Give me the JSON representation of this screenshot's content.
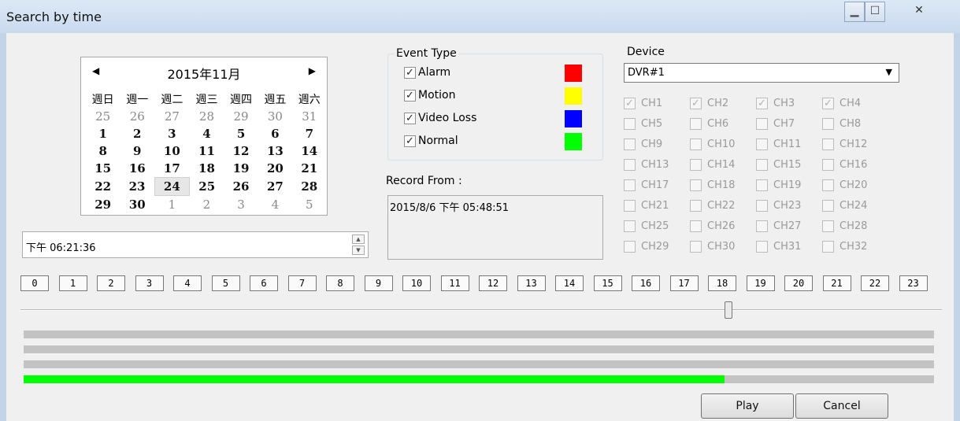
{
  "window": {
    "title": "Search by time"
  },
  "calendar": {
    "month_label": "2015年11月",
    "weekdays": [
      "週日",
      "週一",
      "週二",
      "週三",
      "週四",
      "週五",
      "週六"
    ],
    "rows": [
      [
        [
          "25",
          "other"
        ],
        [
          "26",
          "other"
        ],
        [
          "27",
          "other"
        ],
        [
          "28",
          "other"
        ],
        [
          "29",
          "other"
        ],
        [
          "30",
          "other"
        ],
        [
          "31",
          "other"
        ]
      ],
      [
        [
          "1",
          "cur"
        ],
        [
          "2",
          "cur"
        ],
        [
          "3",
          "cur"
        ],
        [
          "4",
          "cur"
        ],
        [
          "5",
          "cur"
        ],
        [
          "6",
          "cur"
        ],
        [
          "7",
          "cur"
        ]
      ],
      [
        [
          "8",
          "cur"
        ],
        [
          "9",
          "cur"
        ],
        [
          "10",
          "cur"
        ],
        [
          "11",
          "cur"
        ],
        [
          "12",
          "cur"
        ],
        [
          "13",
          "cur"
        ],
        [
          "14",
          "cur"
        ]
      ],
      [
        [
          "15",
          "cur"
        ],
        [
          "16",
          "cur"
        ],
        [
          "17",
          "cur"
        ],
        [
          "18",
          "cur"
        ],
        [
          "19",
          "cur"
        ],
        [
          "20",
          "cur"
        ],
        [
          "21",
          "cur"
        ]
      ],
      [
        [
          "22",
          "cur"
        ],
        [
          "23",
          "cur"
        ],
        [
          "24",
          "today"
        ],
        [
          "25",
          "cur"
        ],
        [
          "26",
          "cur"
        ],
        [
          "27",
          "cur"
        ],
        [
          "28",
          "cur"
        ]
      ],
      [
        [
          "29",
          "cur"
        ],
        [
          "30",
          "cur"
        ],
        [
          "1",
          "other"
        ],
        [
          "2",
          "other"
        ],
        [
          "3",
          "other"
        ],
        [
          "4",
          "other"
        ],
        [
          "5",
          "other"
        ]
      ]
    ]
  },
  "time_field": {
    "value": "下午 06:21:36"
  },
  "event_type": {
    "legend": "Event Type",
    "items": [
      {
        "label": "Alarm",
        "checked": true,
        "color": "#ff0000"
      },
      {
        "label": "Motion",
        "checked": true,
        "color": "#ffff00"
      },
      {
        "label": "Video Loss",
        "checked": true,
        "color": "#0000ff"
      },
      {
        "label": "Normal",
        "checked": true,
        "color": "#00ff00"
      }
    ]
  },
  "record_from": {
    "label": "Record From :",
    "value": "2015/8/6 下午 05:48:51"
  },
  "device": {
    "label": "Device",
    "selected": "DVR#1",
    "channels": [
      {
        "label": "CH1",
        "checked": true
      },
      {
        "label": "CH2",
        "checked": true
      },
      {
        "label": "CH3",
        "checked": true
      },
      {
        "label": "CH4",
        "checked": true
      },
      {
        "label": "CH5",
        "checked": false
      },
      {
        "label": "CH6",
        "checked": false
      },
      {
        "label": "CH7",
        "checked": false
      },
      {
        "label": "CH8",
        "checked": false
      },
      {
        "label": "CH9",
        "checked": false
      },
      {
        "label": "CH10",
        "checked": false
      },
      {
        "label": "CH11",
        "checked": false
      },
      {
        "label": "CH12",
        "checked": false
      },
      {
        "label": "CH13",
        "checked": false
      },
      {
        "label": "CH14",
        "checked": false
      },
      {
        "label": "CH15",
        "checked": false
      },
      {
        "label": "CH16",
        "checked": false
      },
      {
        "label": "CH17",
        "checked": false
      },
      {
        "label": "CH18",
        "checked": false
      },
      {
        "label": "CH19",
        "checked": false
      },
      {
        "label": "CH20",
        "checked": false
      },
      {
        "label": "CH21",
        "checked": false
      },
      {
        "label": "CH22",
        "checked": false
      },
      {
        "label": "CH23",
        "checked": false
      },
      {
        "label": "CH24",
        "checked": false
      },
      {
        "label": "CH25",
        "checked": false
      },
      {
        "label": "CH26",
        "checked": false
      },
      {
        "label": "CH27",
        "checked": false
      },
      {
        "label": "CH28",
        "checked": false
      },
      {
        "label": "CH29",
        "checked": false
      },
      {
        "label": "CH30",
        "checked": false
      },
      {
        "label": "CH31",
        "checked": false
      },
      {
        "label": "CH32",
        "checked": false
      }
    ]
  },
  "timeline": {
    "hours": [
      "0",
      "1",
      "2",
      "3",
      "4",
      "5",
      "6",
      "7",
      "8",
      "9",
      "10",
      "11",
      "12",
      "13",
      "14",
      "15",
      "16",
      "17",
      "18",
      "19",
      "20",
      "21",
      "22",
      "23"
    ],
    "slider_fraction": 0.768,
    "bars": [
      {
        "fill_fraction": 0,
        "color": "#c3c3c3"
      },
      {
        "fill_fraction": 0,
        "color": "#c3c3c3"
      },
      {
        "fill_fraction": 0,
        "color": "#c3c3c3"
      },
      {
        "fill_fraction": 0.77,
        "color": "#00ff00"
      }
    ]
  },
  "buttons": {
    "play": "Play",
    "cancel": "Cancel"
  }
}
